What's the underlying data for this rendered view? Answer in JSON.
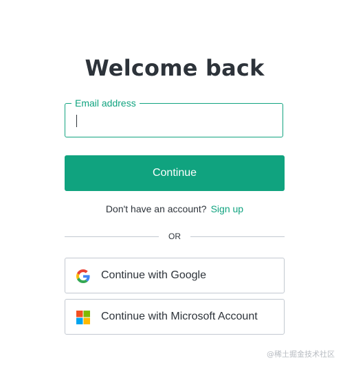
{
  "page": {
    "title": "Welcome back"
  },
  "email": {
    "label": "Email address",
    "value": "",
    "placeholder": ""
  },
  "continue_button": {
    "label": "Continue"
  },
  "signup": {
    "prompt": "Don't have an account?",
    "link": "Sign up"
  },
  "divider": {
    "text": "OR"
  },
  "social": {
    "google": {
      "label": "Continue with Google",
      "icon": "google-icon"
    },
    "microsoft": {
      "label": "Continue with Microsoft Account",
      "icon": "microsoft-icon"
    }
  },
  "watermark": {
    "text": "@稀土掘金技术社区"
  },
  "colors": {
    "accent": "#10a37f",
    "text": "#2d333a",
    "border": "#c2c8d0"
  }
}
